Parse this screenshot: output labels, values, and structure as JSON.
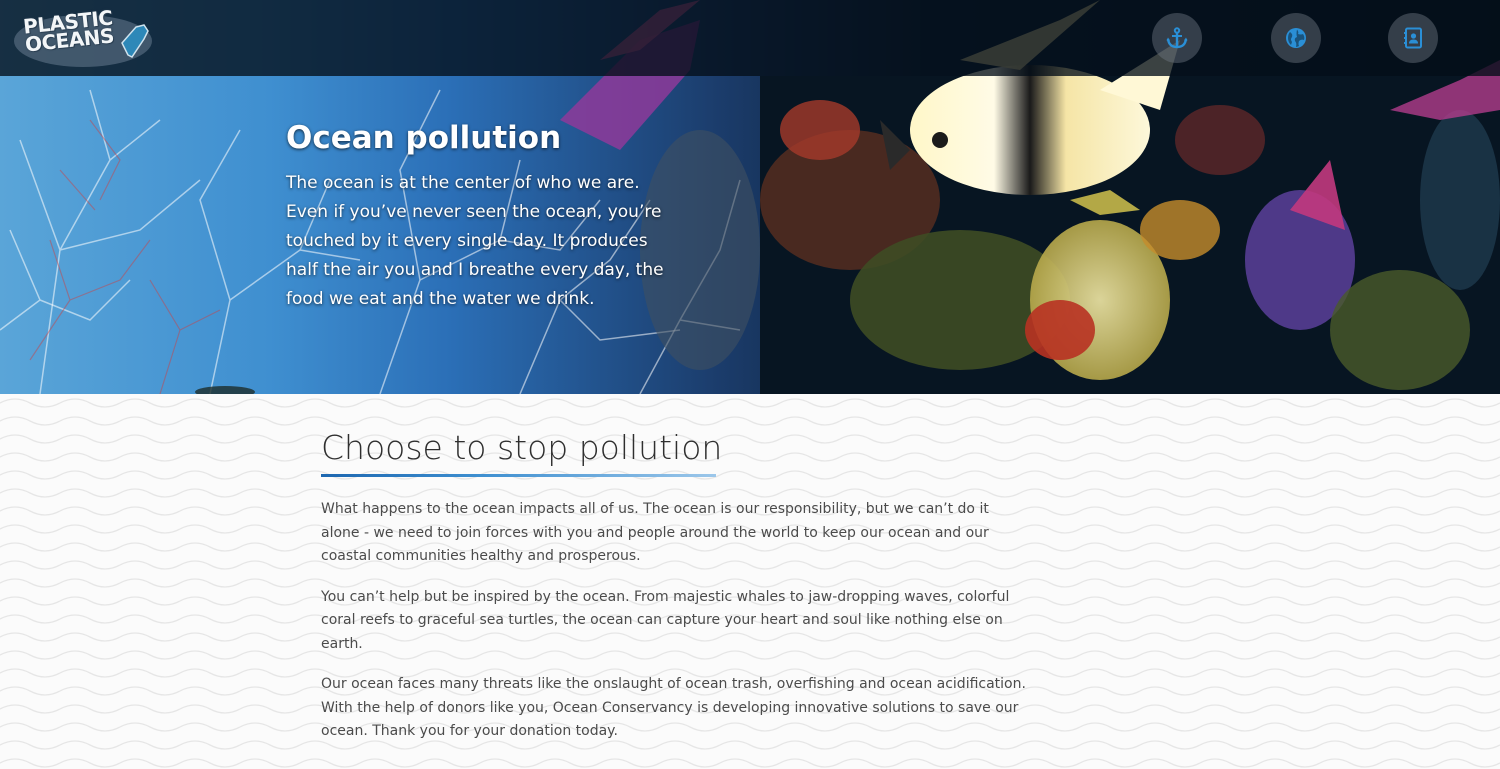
{
  "header": {
    "logo_text": "PLASTIC\nOCEANS",
    "nav_icons": [
      {
        "name": "anchor-icon"
      },
      {
        "name": "globe-icon"
      },
      {
        "name": "contact-book-icon"
      }
    ]
  },
  "hero": {
    "title": "Ocean pollution",
    "body": "The ocean is at the center of who we are. Even if you’ve never seen the ocean, you’re touched by it every single day. It produces half the air you and I breathe every day, the food we eat and the water we drink."
  },
  "main": {
    "title": "Choose to stop pollution",
    "paragraphs": [
      "What happens to the ocean impacts all of us. The ocean is our responsibility, but we can’t do it alone - we need to join forces with you and people around the world to keep our ocean and our coastal communities healthy and prosperous.",
      "You can’t help but be inspired by the ocean. From majestic whales to jaw-dropping waves, colorful coral reefs to graceful sea turtles, the ocean can capture your heart and soul like nothing else on earth.",
      "Our ocean faces many threats like the onslaught of ocean trash, overfishing and ocean acidification. With the help of donors like you, Ocean Conservancy is developing innovative solutions to save our ocean. Thank you for your donation today."
    ]
  },
  "colors": {
    "accent": "#1d67b0",
    "icon": "#2a8fd6"
  }
}
